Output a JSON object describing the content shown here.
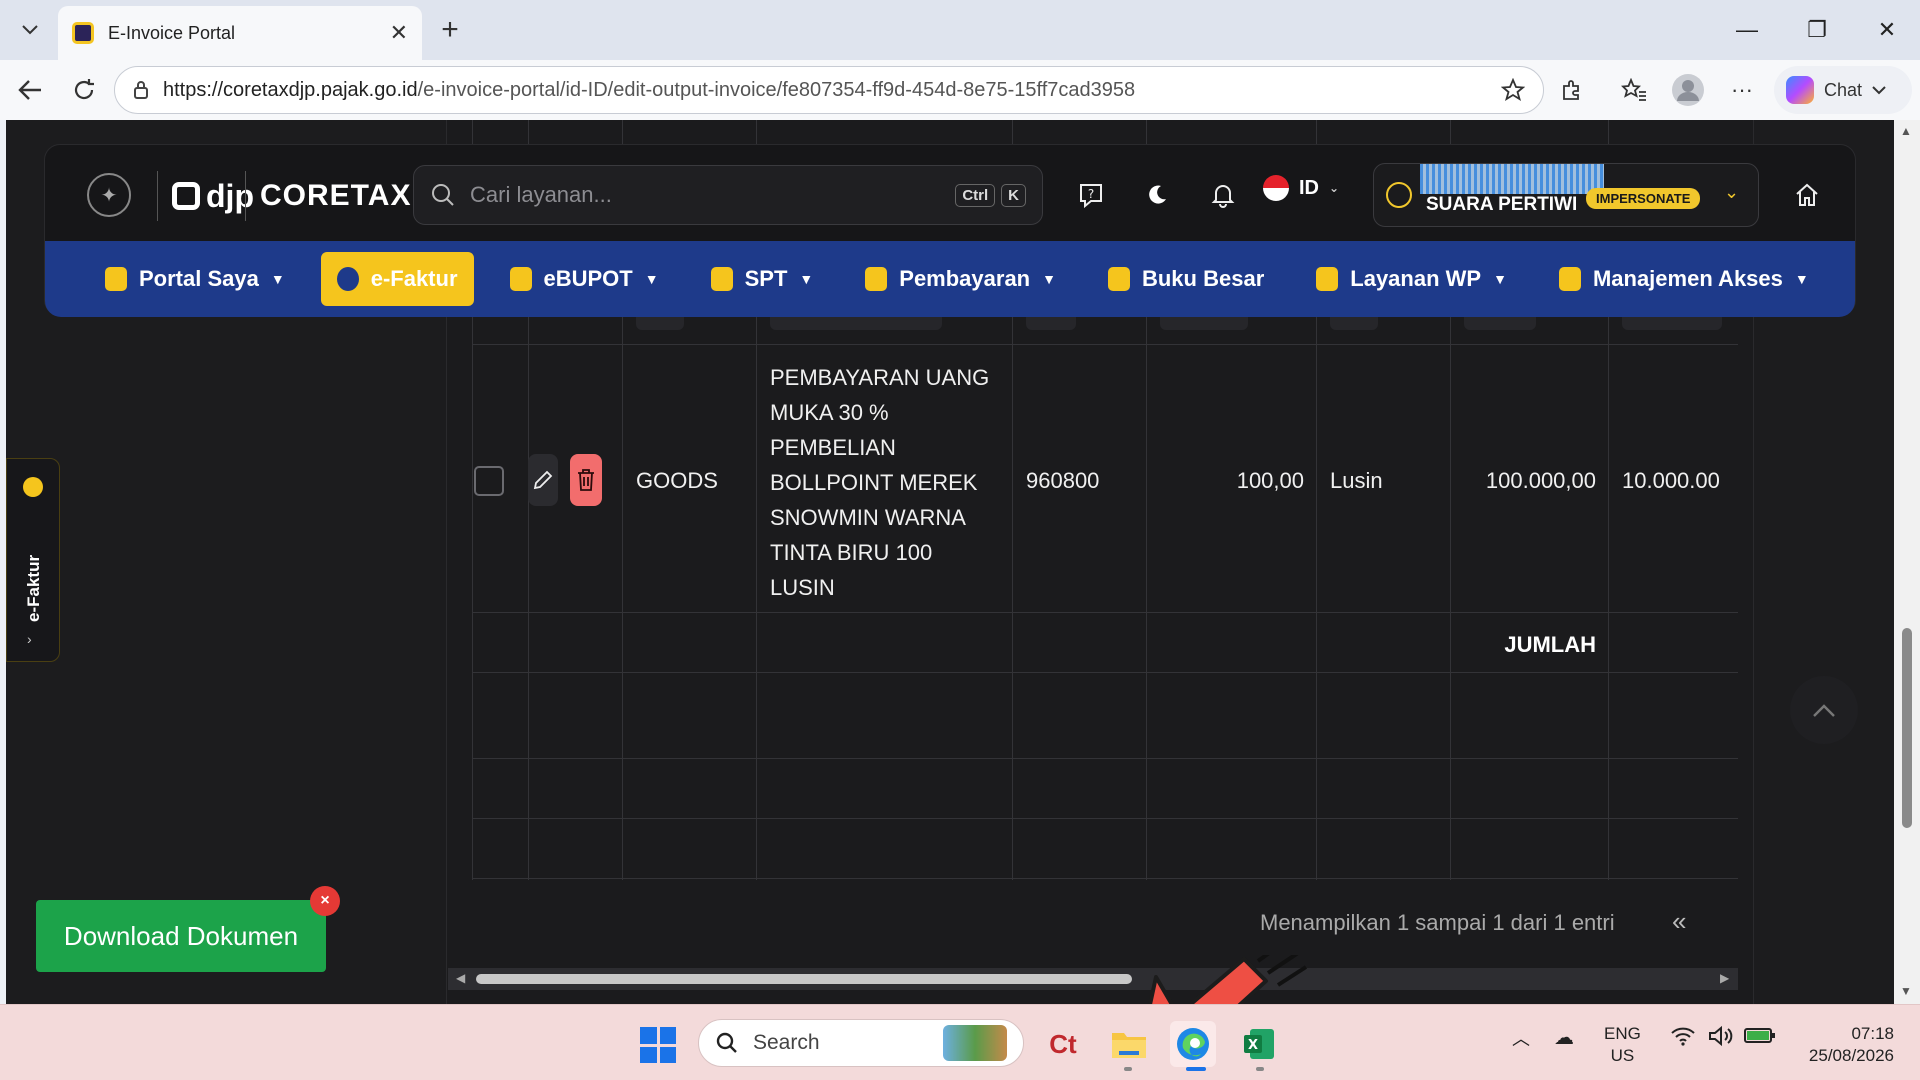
{
  "browser": {
    "tab_title": "E-Invoice Portal",
    "url_host": "https://coretaxdjp.pajak.go.id",
    "url_path": "/e-invoice-portal/id-ID/edit-output-invoice/fe807354-ff9d-454d-8e75-15ff7cad3958",
    "chat_label": "Chat"
  },
  "header": {
    "logo_djp": "djp",
    "logo_coretax": "CORETAX",
    "search_placeholder": "Cari layanan...",
    "shortcut_ctrl": "Ctrl",
    "shortcut_k": "K",
    "language": "ID",
    "user_name": "SUARA PERTIWI",
    "impersonate_badge": "IMPERSONATE"
  },
  "nav": {
    "items": [
      {
        "label": "Portal Saya",
        "has_caret": true
      },
      {
        "label": "e-Faktur",
        "active": true
      },
      {
        "label": "eBUPOT",
        "has_caret": true
      },
      {
        "label": "SPT",
        "has_caret": true
      },
      {
        "label": "Pembayaran",
        "has_caret": true
      },
      {
        "label": "Buku Besar"
      },
      {
        "label": "Layanan WP",
        "has_caret": true
      },
      {
        "label": "Manajemen Akses",
        "has_caret": true
      }
    ]
  },
  "side_tab": {
    "label": "e-Faktur"
  },
  "table": {
    "row": {
      "type": "GOODS",
      "description_lines": [
        "PEMBAYARAN UANG",
        "MUKA 30 %",
        "PEMBELIAN",
        "BOLLPOINT MEREK",
        "SNOWMIN WARNA",
        "TINTA BIRU 100",
        "LUSIN"
      ],
      "code": "960800",
      "quantity": "100,00",
      "unit": "Lusin",
      "unit_price": "100.000,00",
      "total": "10.000.00"
    },
    "total_label": "JUMLAH",
    "pagination_text": "Menampilkan 1 sampai 1 dari 1 entri",
    "prev_page": "«"
  },
  "download_button": {
    "label": "Download Dokumen",
    "close": "×"
  },
  "taskbar": {
    "search_label": "Search",
    "lang_line1": "ENG",
    "lang_line2": "US",
    "time": "07:18",
    "date": "25/08/2026"
  },
  "colors": {
    "nav_bg": "#1e3a8a",
    "accent_yellow": "#f5c51d",
    "delete_red": "#f26d6d",
    "download_green": "#1ca34a",
    "arrow_red": "#ee4f44"
  }
}
